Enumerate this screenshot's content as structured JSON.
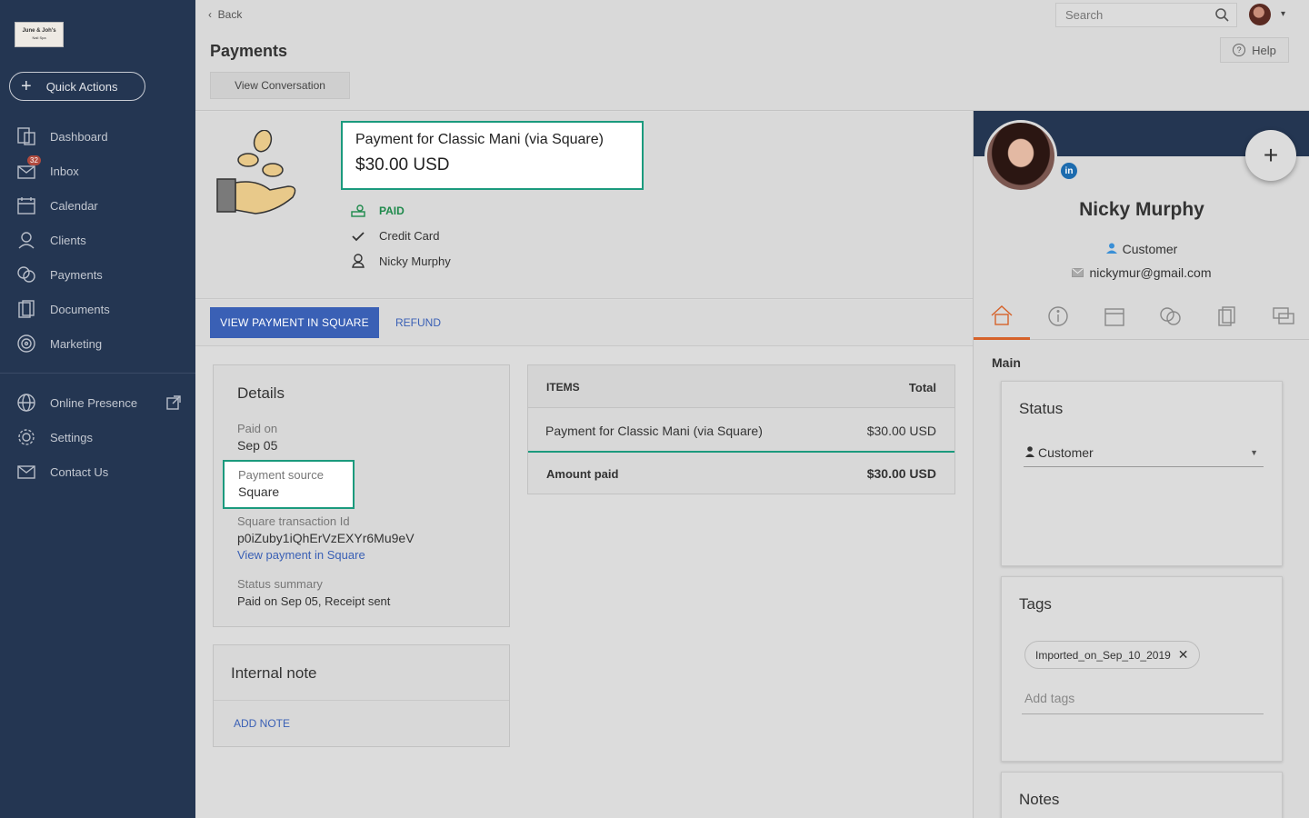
{
  "brand": {
    "logo_line1": "June & Joh's",
    "logo_line2": "Nail Spa"
  },
  "sidebar": {
    "quick_actions": "Quick Actions",
    "items": [
      {
        "label": "Dashboard"
      },
      {
        "label": "Inbox",
        "badge": "32"
      },
      {
        "label": "Calendar"
      },
      {
        "label": "Clients"
      },
      {
        "label": "Payments"
      },
      {
        "label": "Documents"
      },
      {
        "label": "Marketing"
      },
      {
        "label": "Online Presence"
      },
      {
        "label": "Settings"
      },
      {
        "label": "Contact Us"
      }
    ]
  },
  "topbar": {
    "back": "Back",
    "title": "Payments",
    "view_conversation": "View Conversation",
    "search_placeholder": "Search",
    "help": "Help"
  },
  "payment": {
    "title": "Payment for Classic Mani (via Square)",
    "amount": "$30.00 USD",
    "status": "PAID",
    "method": "Credit Card",
    "client": "Nicky Murphy",
    "view_in_square": "VIEW PAYMENT IN SQUARE",
    "refund": "REFUND"
  },
  "details": {
    "title": "Details",
    "paid_on_label": "Paid on",
    "paid_on": "Sep 05",
    "source_label": "Payment source",
    "source": "Square",
    "txn_label": "Square transaction Id",
    "txn": "p0iZuby1iQhErVzEXYr6Mu9eV",
    "view_link": "View payment in Square",
    "summary_label": "Status summary",
    "summary": "Paid on Sep 05, Receipt sent"
  },
  "note": {
    "title": "Internal note",
    "add": "ADD NOTE"
  },
  "items": {
    "col_items": "ITEMS",
    "col_total": "Total",
    "rows": [
      {
        "name": "Payment for Classic Mani (via Square)",
        "total": "$30.00 USD"
      }
    ],
    "amount_paid_label": "Amount paid",
    "amount_paid": "$30.00 USD"
  },
  "profile": {
    "name": "Nicky Murphy",
    "type": "Customer",
    "email": "nickymur@gmail.com",
    "linkedin": "in",
    "section": "Main",
    "status_title": "Status",
    "status_value": "Customer",
    "tags_title": "Tags",
    "tag": "Imported_on_Sep_10_2019",
    "tags_placeholder": "Add tags",
    "notes_title": "Notes"
  },
  "colors": {
    "sidebar": "#243652",
    "accent": "#3a60b5",
    "highlight": "#1b9a7d",
    "tab_active": "#d6622a",
    "paid": "#1f8a4c"
  }
}
